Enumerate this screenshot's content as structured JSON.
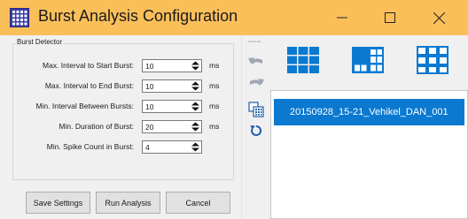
{
  "window": {
    "title": "Burst Analysis Configuration",
    "accent": "#fbbf5a"
  },
  "burst_detector": {
    "group_title": "Burst Detector",
    "fields": [
      {
        "label": "Max. Interval to Start Burst:",
        "value": "10",
        "unit": "ms"
      },
      {
        "label": "Max. Interval to End Burst:",
        "value": "10",
        "unit": "ms"
      },
      {
        "label": "Min. Interval Between Bursts:",
        "value": "10",
        "unit": "ms"
      },
      {
        "label": "Min. Duration of Burst:",
        "value": "20",
        "unit": "ms"
      },
      {
        "label": "Min. Spike Count in Burst:",
        "value": "4",
        "unit": ""
      }
    ]
  },
  "actions": {
    "save_label": "Save Settings",
    "run_label": "Run Analysis",
    "cancel_label": "Cancel"
  },
  "toolbar": {
    "icons": [
      "undo-icon",
      "redo-icon",
      "copy-icon",
      "reset-icon"
    ]
  },
  "layouts": {
    "icons": [
      "grid-3x2-icon",
      "grid-3x3-icon",
      "grid-3x3-outline-icon"
    ]
  },
  "files": {
    "items": [
      "20150928_15-21_Vehikel_DAN_001"
    ],
    "selected_color": "#0b79d0"
  }
}
